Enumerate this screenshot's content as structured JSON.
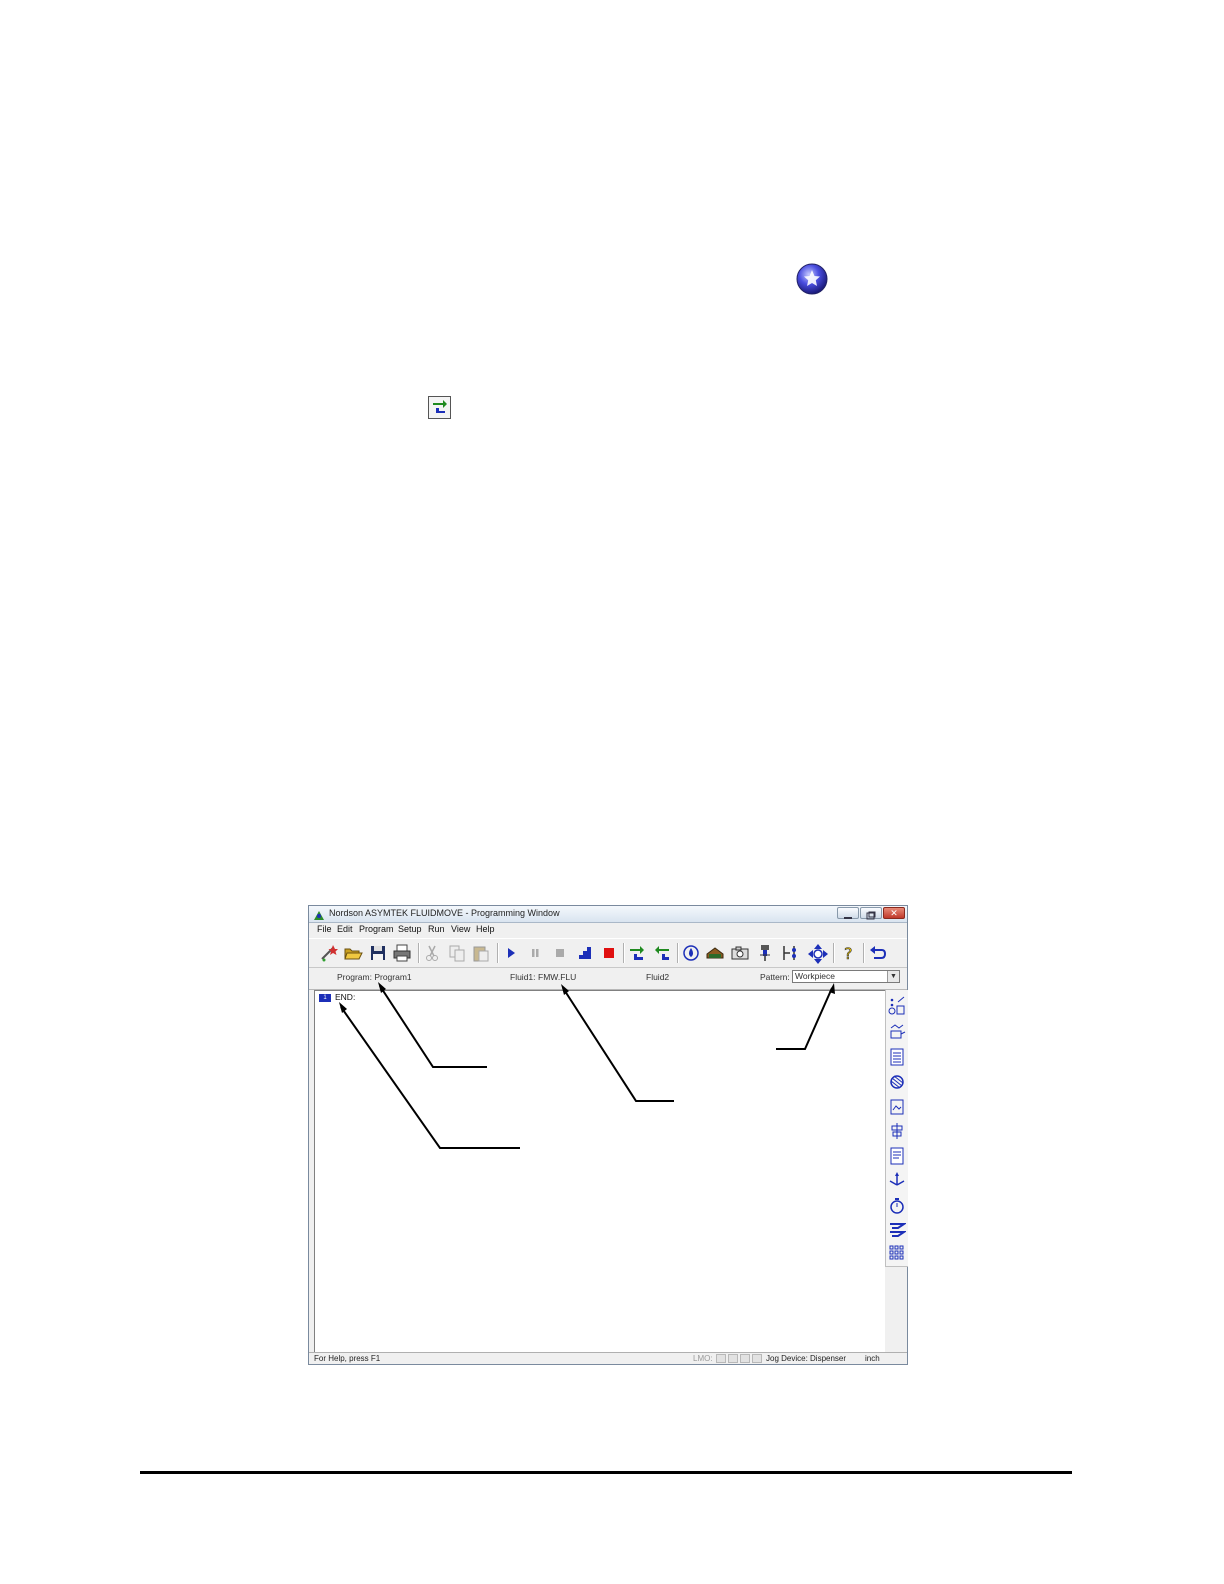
{
  "window": {
    "title": "Nordson ASYMTEK FLUIDMOVE - Programming Window",
    "close_glyph": "✕"
  },
  "menu": {
    "file": "File",
    "edit": "Edit",
    "program": "Program",
    "setup": "Setup",
    "run": "Run",
    "view": "View",
    "help": "Help"
  },
  "info": {
    "program": "Program: Program1",
    "fluid1": "Fluid1:",
    "fluid1_value": "FMW.FLU",
    "fluid2": "Fluid2",
    "pattern_label": "Pattern:",
    "pattern_value": "Workpiece",
    "dropdown_glyph": "▼"
  },
  "editor": {
    "line_number": "1",
    "line_text": "END:"
  },
  "status": {
    "help_text": "For Help, press F1",
    "lmo": "LMO:",
    "jog_device": "Jog Device: Dispenser",
    "units": "inch"
  },
  "colors": {
    "accent_green": "#1f8a1f",
    "accent_blue": "#1c2fb8",
    "stop_red": "#e01010"
  },
  "icons": {
    "page_globe": "globe-star-icon",
    "page_toolbar": "teach-up-icon"
  }
}
